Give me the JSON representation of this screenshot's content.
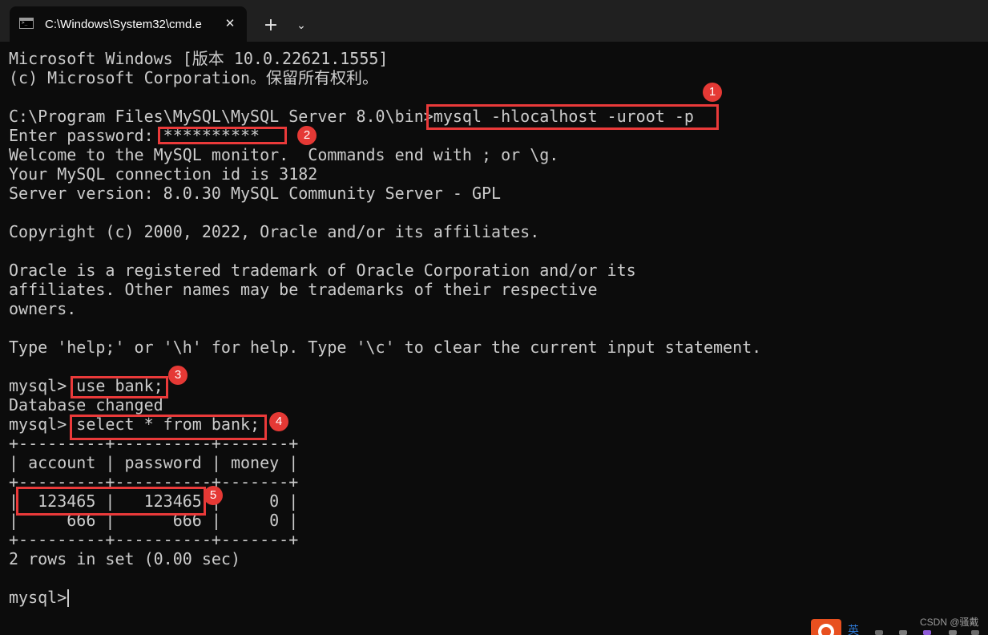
{
  "window": {
    "tab_title": "C:\\Windows\\System32\\cmd.e",
    "close_glyph": "✕",
    "new_tab_glyph": "+",
    "dropdown_glyph": "⌄",
    "tab_icon": "cmd-terminal-icon"
  },
  "terminal": {
    "lines": [
      "Microsoft Windows [版本 10.0.22621.1555]",
      "(c) Microsoft Corporation。保留所有权利。",
      "",
      "C:\\Program Files\\MySQL\\MySQL Server 8.0\\bin>mysql -hlocalhost -uroot -p",
      "Enter password: **********",
      "Welcome to the MySQL monitor.  Commands end with ; or \\g.",
      "Your MySQL connection id is 3182",
      "Server version: 8.0.30 MySQL Community Server - GPL",
      "",
      "Copyright (c) 2000, 2022, Oracle and/or its affiliates.",
      "",
      "Oracle is a registered trademark of Oracle Corporation and/or its",
      "affiliates. Other names may be trademarks of their respective",
      "owners.",
      "",
      "Type 'help;' or '\\h' for help. Type '\\c' to clear the current input statement.",
      "",
      "mysql> use bank;",
      "Database changed",
      "mysql> select * from bank;",
      "+---------+----------+-------+",
      "| account | password | money |",
      "+---------+----------+-------+",
      "|  123465 |   123465 |     0 |",
      "|     666 |      666 |     0 |",
      "+---------+----------+-------+",
      "2 rows in set (0.00 sec)",
      "",
      "mysql> "
    ]
  },
  "annotations": {
    "badges": [
      "1",
      "2",
      "3",
      "4",
      "5"
    ],
    "color": "#e53935"
  },
  "watermark": "CSDN @骚戴",
  "tray": {
    "char": "英"
  },
  "colors": {
    "background": "#0c0c0c",
    "tabbar": "#202020",
    "text": "#cccccc",
    "highlight": "#ea3a3a"
  }
}
